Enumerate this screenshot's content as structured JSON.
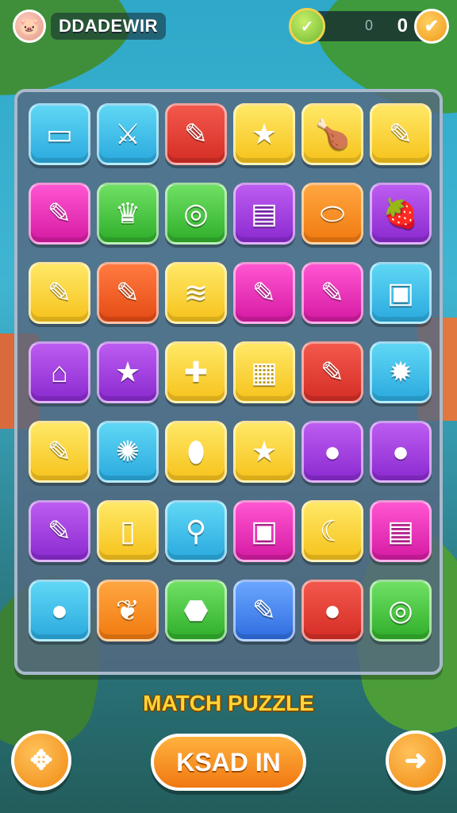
{
  "header": {
    "player_name": "DDADEWIR",
    "score_secondary": "0",
    "score_value": "0"
  },
  "board": {
    "rows": [
      [
        {
          "color": "c-cyan",
          "icon": "card-icon",
          "glyph": "▭"
        },
        {
          "color": "c-cyan",
          "icon": "sword-icon",
          "glyph": "⚔"
        },
        {
          "color": "c-red",
          "icon": "pencil-icon",
          "glyph": "✎"
        },
        {
          "color": "c-yellow",
          "icon": "star-icon",
          "glyph": "★"
        },
        {
          "color": "c-yellow",
          "icon": "drumstick-icon",
          "glyph": "🍗"
        },
        {
          "color": "c-yellow",
          "icon": "pencil-icon",
          "glyph": "✎"
        }
      ],
      [
        {
          "color": "c-magenta",
          "icon": "marker-icon",
          "glyph": "✎"
        },
        {
          "color": "c-green",
          "icon": "crown-icon",
          "glyph": "♛"
        },
        {
          "color": "c-green",
          "icon": "ring-icon",
          "glyph": "◎"
        },
        {
          "color": "c-purple",
          "icon": "ruler-icon",
          "glyph": "▤"
        },
        {
          "color": "c-orange",
          "icon": "capsule-icon",
          "glyph": "⬭"
        },
        {
          "color": "c-purple",
          "icon": "strawberry-icon",
          "glyph": "🍓"
        }
      ],
      [
        {
          "color": "c-yellow",
          "icon": "pencil-icon",
          "glyph": "✎"
        },
        {
          "color": "c-orangered",
          "icon": "pencil-icon",
          "glyph": "✎"
        },
        {
          "color": "c-yellow",
          "icon": "cloth-icon",
          "glyph": "≋"
        },
        {
          "color": "c-magenta",
          "icon": "crayon-icon",
          "glyph": "✎"
        },
        {
          "color": "c-magenta",
          "icon": "crayon-icon",
          "glyph": "✎"
        },
        {
          "color": "c-cyan",
          "icon": "robot-icon",
          "glyph": "▣"
        }
      ],
      [
        {
          "color": "c-purple",
          "icon": "house-icon",
          "glyph": "⌂"
        },
        {
          "color": "c-purple",
          "icon": "star-icon",
          "glyph": "★"
        },
        {
          "color": "c-yellow",
          "icon": "pin-icon",
          "glyph": "✚"
        },
        {
          "color": "c-yellow",
          "icon": "calculator-icon",
          "glyph": "▦"
        },
        {
          "color": "c-red",
          "icon": "marker-icon",
          "glyph": "✎"
        },
        {
          "color": "c-cyan",
          "icon": "gear-icon",
          "glyph": "✹"
        }
      ],
      [
        {
          "color": "c-yellow",
          "icon": "crayon-icon",
          "glyph": "✎"
        },
        {
          "color": "c-cyan",
          "icon": "blob-icon",
          "glyph": "✺"
        },
        {
          "color": "c-yellow",
          "icon": "eggplant-icon",
          "glyph": "⬮"
        },
        {
          "color": "c-yellow",
          "icon": "star-icon",
          "glyph": "★"
        },
        {
          "color": "c-purple",
          "icon": "lollipop-icon",
          "glyph": "●"
        },
        {
          "color": "c-purple",
          "icon": "tomato-icon",
          "glyph": "●"
        }
      ],
      [
        {
          "color": "c-purple",
          "icon": "pencil-icon",
          "glyph": "✎"
        },
        {
          "color": "c-yellow",
          "icon": "bottle-icon",
          "glyph": "▯"
        },
        {
          "color": "c-cyan",
          "icon": "magnifier-icon",
          "glyph": "⚲"
        },
        {
          "color": "c-magenta",
          "icon": "robot-icon",
          "glyph": "▣"
        },
        {
          "color": "c-yellow",
          "icon": "moon-icon",
          "glyph": "☾"
        },
        {
          "color": "c-magenta",
          "icon": "cake-icon",
          "glyph": "▤"
        }
      ],
      [
        {
          "color": "c-cyan",
          "icon": "chat-bubble-icon",
          "glyph": "●"
        },
        {
          "color": "c-orange",
          "icon": "leaf-icon",
          "glyph": "❦"
        },
        {
          "color": "c-green",
          "icon": "cookie-icon",
          "glyph": "⬣"
        },
        {
          "color": "c-blue",
          "icon": "pencil-icon",
          "glyph": "✎"
        },
        {
          "color": "c-red",
          "icon": "balloon-icon",
          "glyph": "●"
        },
        {
          "color": "c-green",
          "icon": "donut-icon",
          "glyph": "◎"
        }
      ]
    ]
  },
  "footer": {
    "title": "MATCH PUZZLE",
    "main_button_label": "KSAD IN"
  }
}
